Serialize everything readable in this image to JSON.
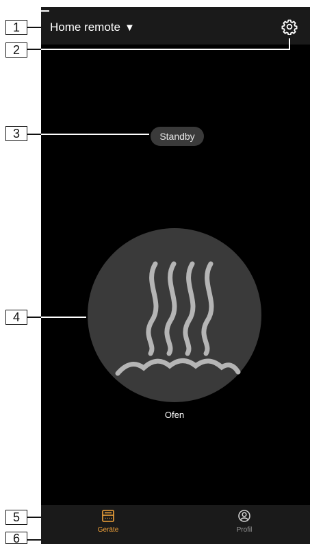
{
  "callouts": [
    "1",
    "2",
    "3",
    "4",
    "5",
    "6"
  ],
  "header": {
    "title": "Home remote",
    "caret": "▼",
    "settings_icon": "gear-icon"
  },
  "status": {
    "label": "Standby"
  },
  "device": {
    "name": "Ofen",
    "icon": "heater-icon"
  },
  "nav": {
    "items": [
      {
        "label": "Geräte",
        "icon": "devices-icon",
        "active": true
      },
      {
        "label": "Profil",
        "icon": "profile-icon",
        "active": false
      }
    ]
  },
  "colors": {
    "background": "#000000",
    "bar": "#1a1a1a",
    "surface": "#3a3a3a",
    "icon_stroke": "#b5b5b5",
    "accent": "#f2a33a",
    "inactive": "#9a9a9a"
  }
}
